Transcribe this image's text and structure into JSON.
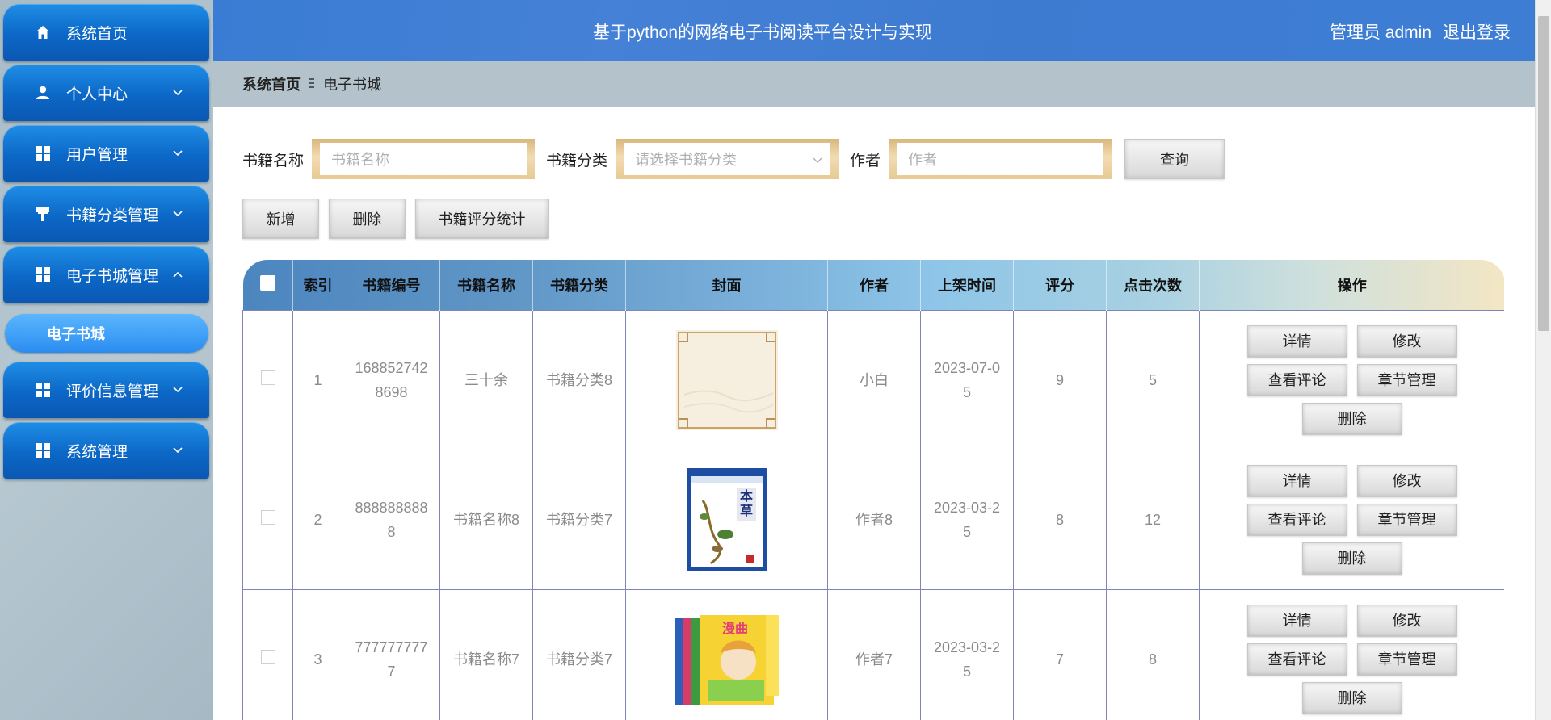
{
  "sidebar": {
    "items": [
      {
        "label": "系统首页",
        "icon": "home-icon",
        "arrow": ""
      },
      {
        "label": "个人中心",
        "icon": "user-icon",
        "arrow": "down"
      },
      {
        "label": "用户管理",
        "icon": "grid-icon",
        "arrow": "down"
      },
      {
        "label": "书籍分类管理",
        "icon": "brush-icon",
        "arrow": "down"
      },
      {
        "label": "电子书城管理",
        "icon": "grid-icon",
        "arrow": "up"
      },
      {
        "label": "评价信息管理",
        "icon": "grid-icon",
        "arrow": "down"
      },
      {
        "label": "系统管理",
        "icon": "grid-icon",
        "arrow": "down"
      }
    ],
    "sub_item": "电子书城"
  },
  "header": {
    "title": "基于python的网络电子书阅读平台设计与实现",
    "user": "管理员 admin",
    "logout": "退出登录"
  },
  "breadcrumb": {
    "home": "系统首页",
    "current": "电子书城"
  },
  "search": {
    "name_label": "书籍名称",
    "name_placeholder": "书籍名称",
    "category_label": "书籍分类",
    "category_placeholder": "请选择书籍分类",
    "author_label": "作者",
    "author_placeholder": "作者",
    "query_button": "查询"
  },
  "actions": {
    "add": "新增",
    "delete": "删除",
    "stats": "书籍评分统计"
  },
  "table": {
    "columns": [
      "索引",
      "书籍编号",
      "书籍名称",
      "书籍分类",
      "封面",
      "作者",
      "上架时间",
      "评分",
      "点击次数",
      "操作"
    ],
    "rows": [
      {
        "index": "1",
        "id": "1688527428698",
        "name": "三十余",
        "category": "书籍分类8",
        "cover": "plain-cream",
        "author": "小白",
        "time": "2023-07-05",
        "score": "9",
        "clicks": "5"
      },
      {
        "index": "2",
        "id": "8888888888",
        "name": "书籍名称8",
        "category": "书籍分类7",
        "cover": "herbal-book",
        "author": "作者8",
        "time": "2023-03-25",
        "score": "8",
        "clicks": "12"
      },
      {
        "index": "3",
        "id": "7777777777",
        "name": "书籍名称7",
        "category": "书籍分类7",
        "cover": "manga-books",
        "author": "作者7",
        "time": "2023-03-25",
        "score": "7",
        "clicks": "8"
      }
    ],
    "row_actions": {
      "detail": "详情",
      "edit": "修改",
      "comments": "查看评论",
      "chapters": "章节管理",
      "delete": "删除"
    }
  },
  "colors": {
    "header_bg": "#3d7ed4",
    "menu_bg": "#0c67c6",
    "submenu_bg": "#2b8cf0",
    "table_border": "#7f85b8"
  }
}
